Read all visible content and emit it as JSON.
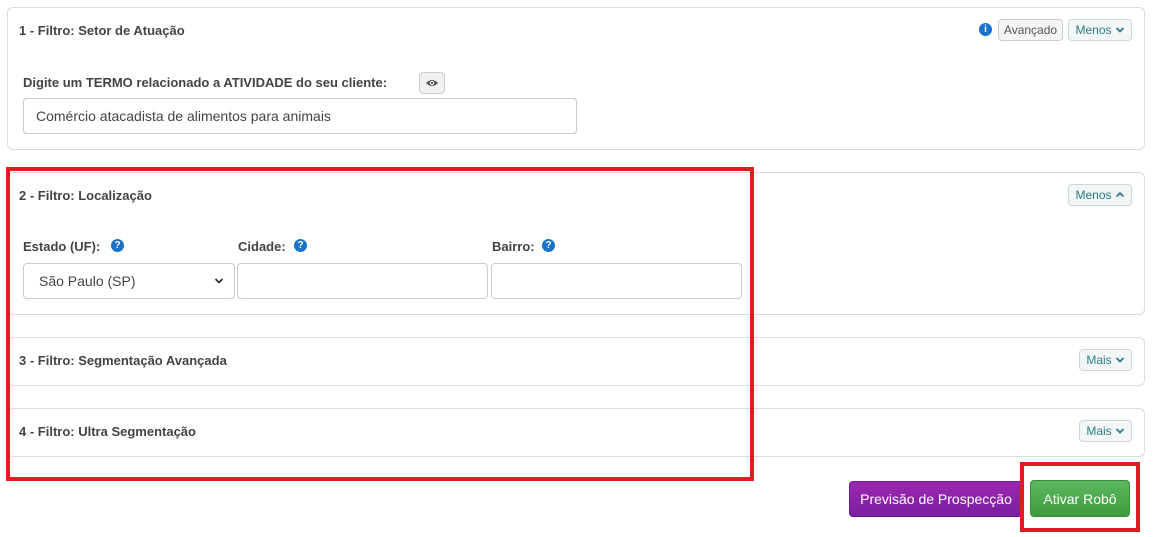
{
  "colors": {
    "accent_teal": "#2a7d86",
    "info_blue": "#1a73c9",
    "highlight_red": "#e01b24",
    "preview_purple": "#8e24aa",
    "activate_green": "#4caf50"
  },
  "filter1": {
    "title": "1 - Filtro: Setor de Atuação",
    "info_icon": "info-icon",
    "advanced_label": "Avançado",
    "toggle_label": "Menos",
    "toggle_icon": "chevron-down-icon",
    "term_label": "Digite um TERMO relacionado a ATIVIDADE do seu cliente:",
    "eye_icon": "eye-icon",
    "term_value": "Comércio atacadista de alimentos para animais"
  },
  "filter2": {
    "title": "2 - Filtro: Localização",
    "toggle_label": "Menos",
    "toggle_icon": "chevron-up-icon",
    "state_label": "Estado (UF):",
    "state_value": "São Paulo (SP)",
    "city_label": "Cidade:",
    "city_value": "",
    "neighborhood_label": "Bairro:",
    "neighborhood_value": "",
    "help_icon": "question-icon"
  },
  "filter3": {
    "title": "3 - Filtro: Segmentação Avançada",
    "toggle_label": "Mais",
    "toggle_icon": "chevron-down-icon"
  },
  "filter4": {
    "title": "4 - Filtro: Ultra Segmentação",
    "toggle_label": "Mais",
    "toggle_icon": "chevron-down-icon"
  },
  "actions": {
    "preview_label": "Previsão de Prospecção",
    "activate_label": "Ativar Robô"
  }
}
